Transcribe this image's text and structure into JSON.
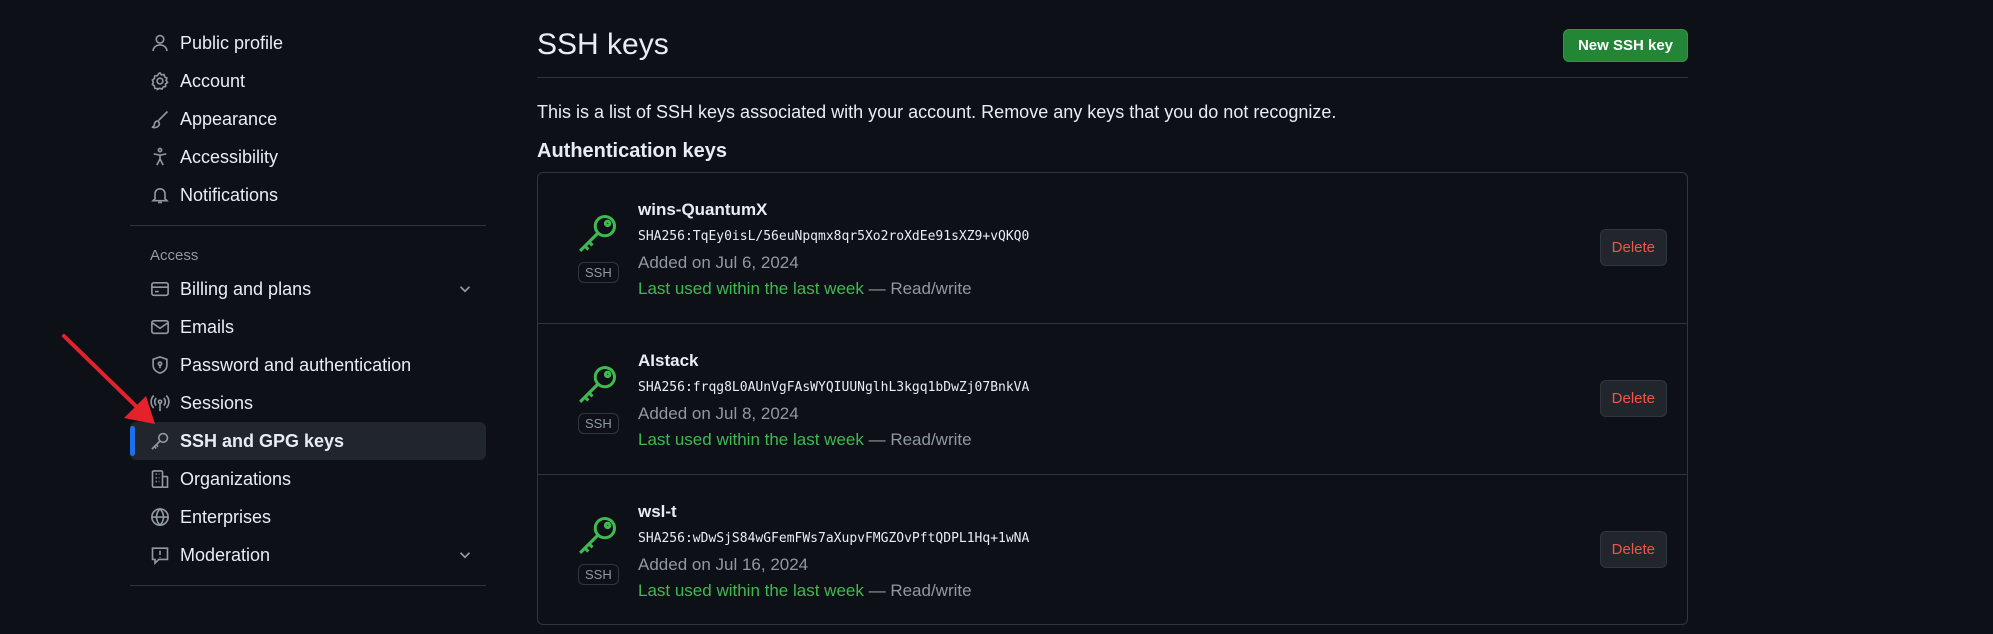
{
  "sidebar": {
    "top_items": [
      {
        "label": "Public profile",
        "icon": "person-icon"
      },
      {
        "label": "Account",
        "icon": "gear-icon"
      },
      {
        "label": "Appearance",
        "icon": "paintbrush-icon"
      },
      {
        "label": "Accessibility",
        "icon": "accessibility-icon"
      },
      {
        "label": "Notifications",
        "icon": "bell-icon"
      }
    ],
    "access_label": "Access",
    "access_items": [
      {
        "label": "Billing and plans",
        "icon": "credit-card-icon"
      },
      {
        "label": "Emails",
        "icon": "mail-icon"
      },
      {
        "label": "Password and authentication",
        "icon": "shield-lock-icon"
      },
      {
        "label": "Sessions",
        "icon": "broadcast-icon"
      },
      {
        "label": "SSH and GPG keys",
        "icon": "key-icon"
      },
      {
        "label": "Organizations",
        "icon": "organization-icon"
      },
      {
        "label": "Enterprises",
        "icon": "globe-icon"
      },
      {
        "label": "Moderation",
        "icon": "report-icon"
      }
    ]
  },
  "main": {
    "title": "SSH keys",
    "new_button": "New SSH key",
    "intro": "This is a list of SSH keys associated with your account. Remove any keys that you do not recognize.",
    "section_title": "Authentication keys",
    "keys": [
      {
        "name": "wins-QuantumX",
        "fingerprint": "SHA256:TqEy0isL/56euNpqmx8qr5Xo2roXdEe91sXZ9+vQKQ0",
        "added": "Added on Jul 6, 2024",
        "last_used": "Last used within the last week",
        "access": "— Read/write",
        "type_label": "SSH",
        "delete_label": "Delete"
      },
      {
        "name": "AIstack",
        "fingerprint": "SHA256:frqg8L0AUnVgFAsWYQIUUNglhL3kgq1bDwZj07BnkVA",
        "added": "Added on Jul 8, 2024",
        "last_used": "Last used within the last week",
        "access": "— Read/write",
        "type_label": "SSH",
        "delete_label": "Delete"
      },
      {
        "name": "wsl-t",
        "fingerprint": "SHA256:wDwSjS84wGFemFWs7aXupvFMGZOvPftQDPL1Hq+1wNA",
        "added": "Added on Jul 16, 2024",
        "last_used": "Last used within the last week",
        "access": "— Read/write",
        "type_label": "SSH",
        "delete_label": "Delete"
      }
    ]
  },
  "colors": {
    "background": "#0d1117",
    "accent_blue": "#1f6feb",
    "green": "#3fb950",
    "button_green": "#238636",
    "danger": "#f85149",
    "annotation_arrow": "#e5222b"
  }
}
